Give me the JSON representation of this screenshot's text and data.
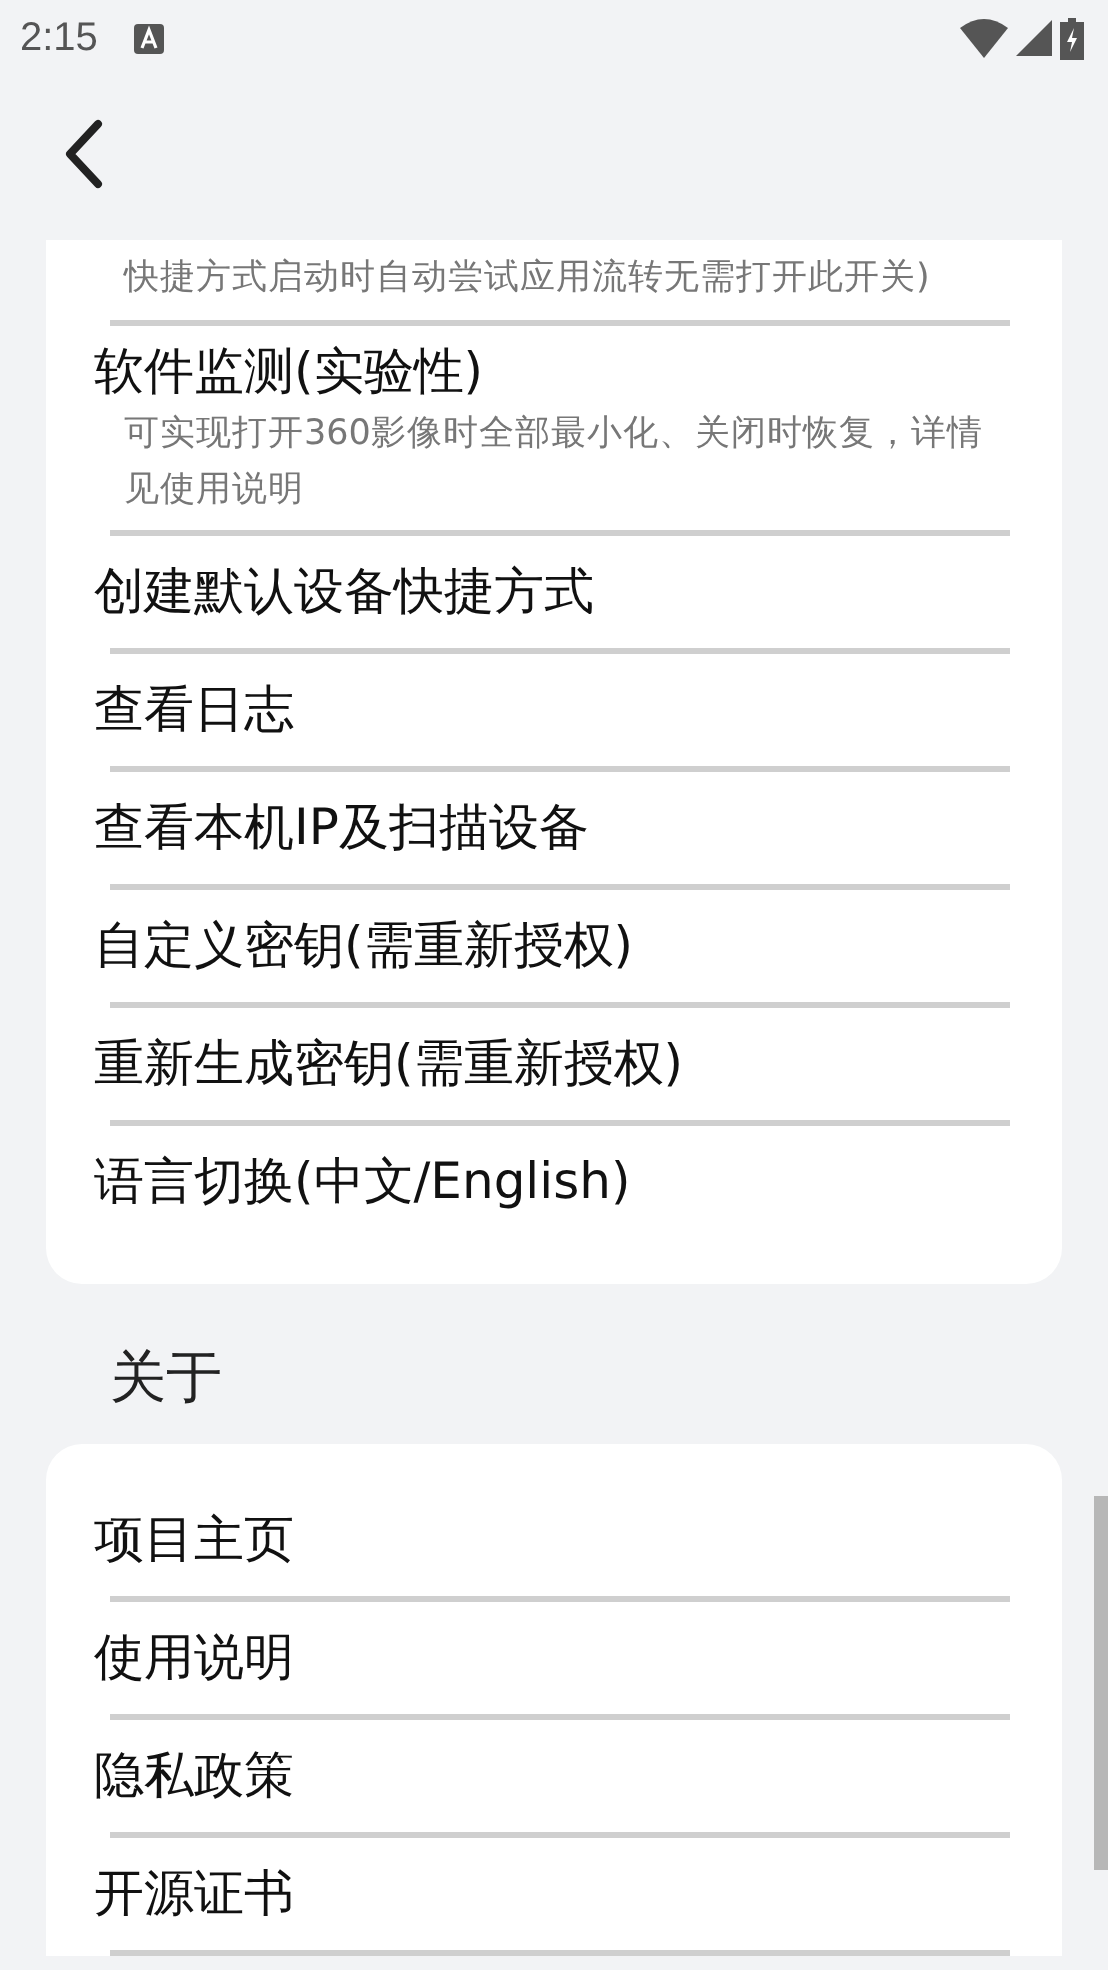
{
  "status_bar": {
    "time": "2:15"
  },
  "sections": [
    {
      "continues": false,
      "items": [
        {
          "kind": "note",
          "subtitle": "快捷方式启动时自动尝试应用流转无需打开此开关)"
        },
        {
          "kind": "item",
          "title": "软件监测(实验性)",
          "subtitle": "可实现打开360影像时全部最小化、关闭时恢复，详情见使用说明"
        },
        {
          "kind": "item",
          "title": "创建默认设备快捷方式"
        },
        {
          "kind": "item",
          "title": "查看日志"
        },
        {
          "kind": "item",
          "title": "查看本机IP及扫描设备"
        },
        {
          "kind": "item",
          "title": "自定义密钥(需重新授权)"
        },
        {
          "kind": "item",
          "title": "重新生成密钥(需重新授权)"
        },
        {
          "kind": "item",
          "title": "语言切换(中文/English)"
        }
      ]
    },
    {
      "header": "关于",
      "continues": true,
      "items": [
        {
          "kind": "item",
          "title": "项目主页"
        },
        {
          "kind": "item",
          "title": "使用说明"
        },
        {
          "kind": "item",
          "title": "隐私政策"
        },
        {
          "kind": "item",
          "title": "开源证书"
        }
      ]
    }
  ]
}
